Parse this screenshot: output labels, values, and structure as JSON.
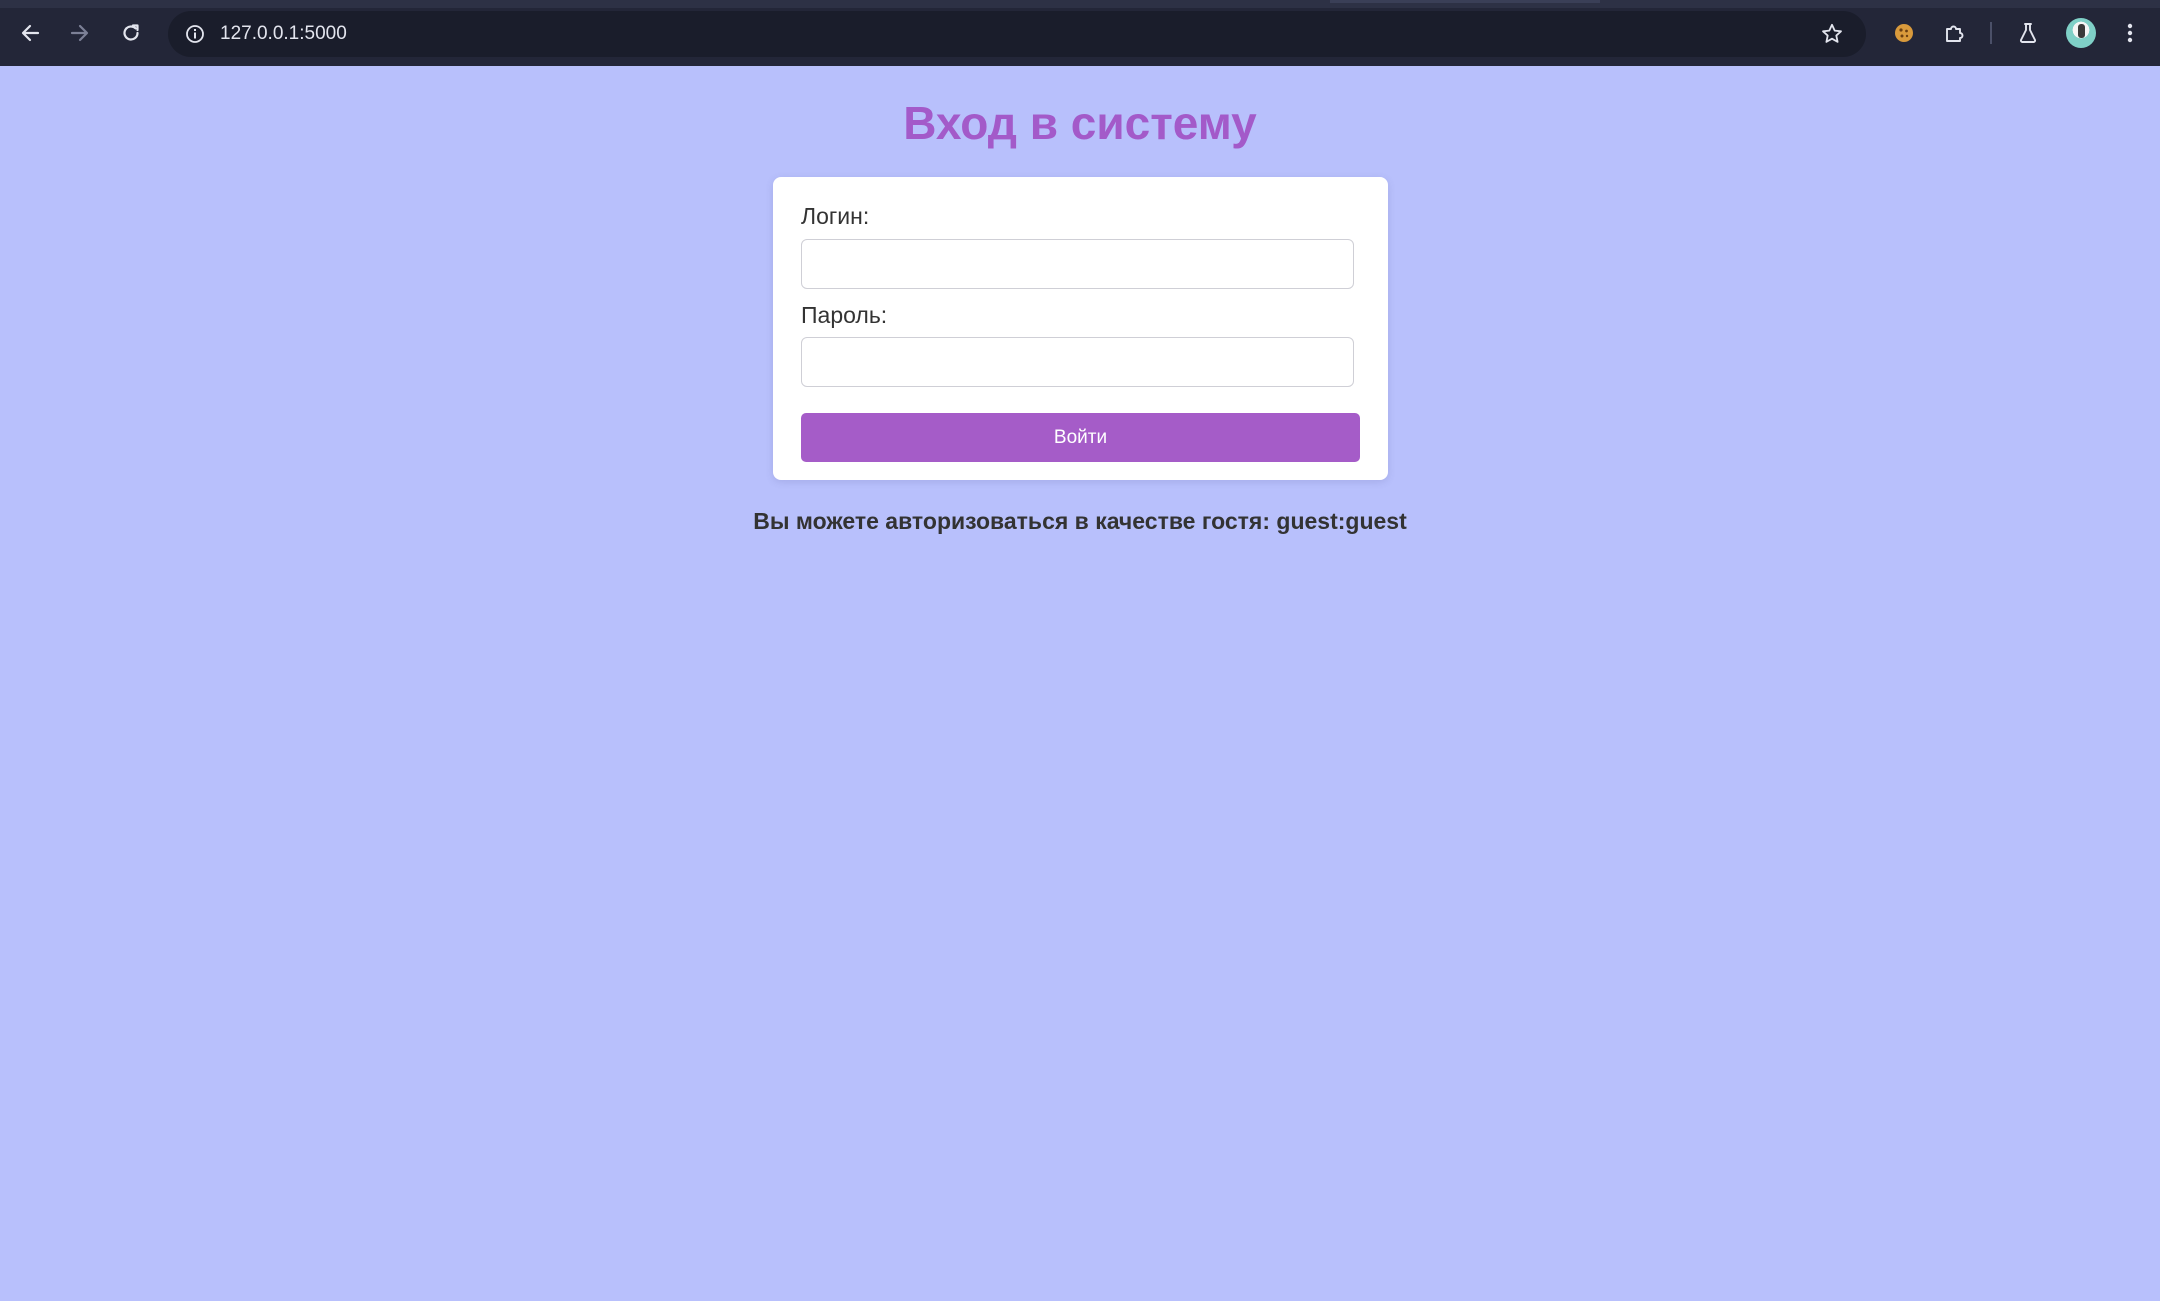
{
  "browser": {
    "url": "127.0.0.1:5000",
    "icons": {
      "back": "arrow-left-icon",
      "forward": "arrow-right-icon",
      "reload": "reload-icon",
      "site_info": "info-icon",
      "bookmark": "star-icon",
      "cookie_extension": "cookie-icon",
      "extensions": "puzzle-icon",
      "labs": "flask-icon",
      "profile": "avatar",
      "menu": "kebab-menu-icon"
    }
  },
  "page": {
    "title": "Вход в систему",
    "background_color": "#b8c0fc",
    "accent_color": "#a55cc8",
    "form": {
      "login_label": "Логин:",
      "login_value": "",
      "password_label": "Пароль:",
      "password_value": "",
      "submit_label": "Войти"
    },
    "guest_hint": "Вы можете авторизоваться в качестве гостя: guest:guest"
  }
}
